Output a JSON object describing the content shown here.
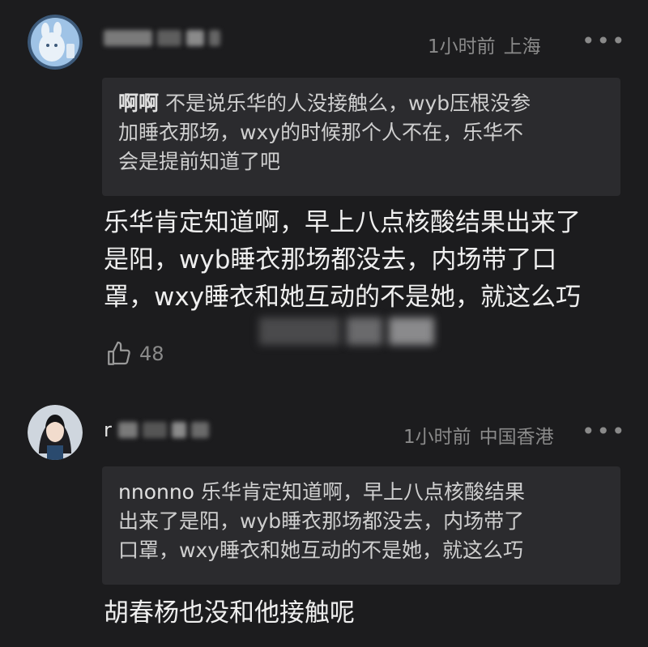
{
  "comments": [
    {
      "time": "1小时前",
      "location": "上海",
      "more_label": "•••",
      "quote": {
        "author": "啊啊",
        "lines": [
          "不是说乐华的人没接触么，wyb压根没参",
          "加睡衣那场，wxy的时候那个人不在，乐华不",
          "会是提前知道了吧"
        ]
      },
      "body_lines": [
        "乐华肯定知道啊，早上八点核酸结果出来了",
        "是阳，wyb睡衣那场都没去，内场带了口",
        "罩，wxy睡衣和她互动的不是她，就这么巧"
      ],
      "likes": "48",
      "avatar_icon": "cartoon-avatar-icon",
      "like_icon": "thumbs-up-icon"
    },
    {
      "name_visible": "r",
      "time": "1小时前",
      "location": "中国香港",
      "more_label": "•••",
      "quote": {
        "author": "nnonno",
        "lines": [
          "乐华肯定知道啊，早上八点核酸结果",
          "出来了是阳，wyb睡衣那场都没去，内场带了",
          "口罩，wxy睡衣和她互动的不是她，就这么巧"
        ]
      },
      "body_lines": [
        "胡春杨也没和他接触呢"
      ],
      "avatar_icon": "girl-photo-avatar-icon"
    }
  ],
  "colors": {
    "background": "#1c1c1e",
    "quote_background": "#2b2b2e",
    "meta_text": "#8a8a8a"
  }
}
